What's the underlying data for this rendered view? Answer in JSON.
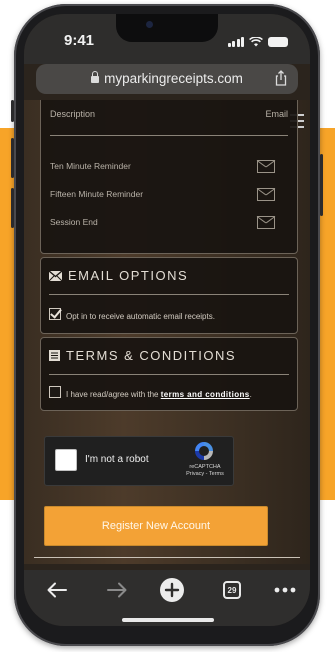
{
  "status_bar": {
    "time": "9:41"
  },
  "browser": {
    "url": "myparkingreceipts.com",
    "tab_count": "29"
  },
  "reminders": {
    "header_description": "Description",
    "header_email": "Email",
    "rows": [
      {
        "label": "Ten Minute Reminder"
      },
      {
        "label": "Fifteen Minute Reminder"
      },
      {
        "label": "Session End"
      }
    ]
  },
  "email_options": {
    "title": "EMAIL OPTIONS",
    "opt_in_label": "Opt in to receive automatic email receipts.",
    "opt_in_checked": true
  },
  "terms": {
    "title": "TERMS & CONDITIONS",
    "agree_prefix": "I have read/agree with the ",
    "agree_link": "terms and conditions",
    "agree_suffix": "."
  },
  "recaptcha": {
    "label": "I'm not a robot",
    "brand": "reCAPTCHA",
    "links": "Privacy - Terms"
  },
  "register_button": {
    "label": "Register New Account"
  },
  "colors": {
    "background_accent": "#f7a428",
    "register_button": "#f3a236"
  },
  "icons": [
    "lock-icon",
    "share-icon",
    "menu-icon",
    "envelope-icon",
    "mail-icon",
    "document-icon",
    "checkbox-icon",
    "recaptcha-logo-icon",
    "back-arrow-icon",
    "forward-arrow-icon",
    "new-tab-icon",
    "tabs-icon",
    "more-icon"
  ]
}
